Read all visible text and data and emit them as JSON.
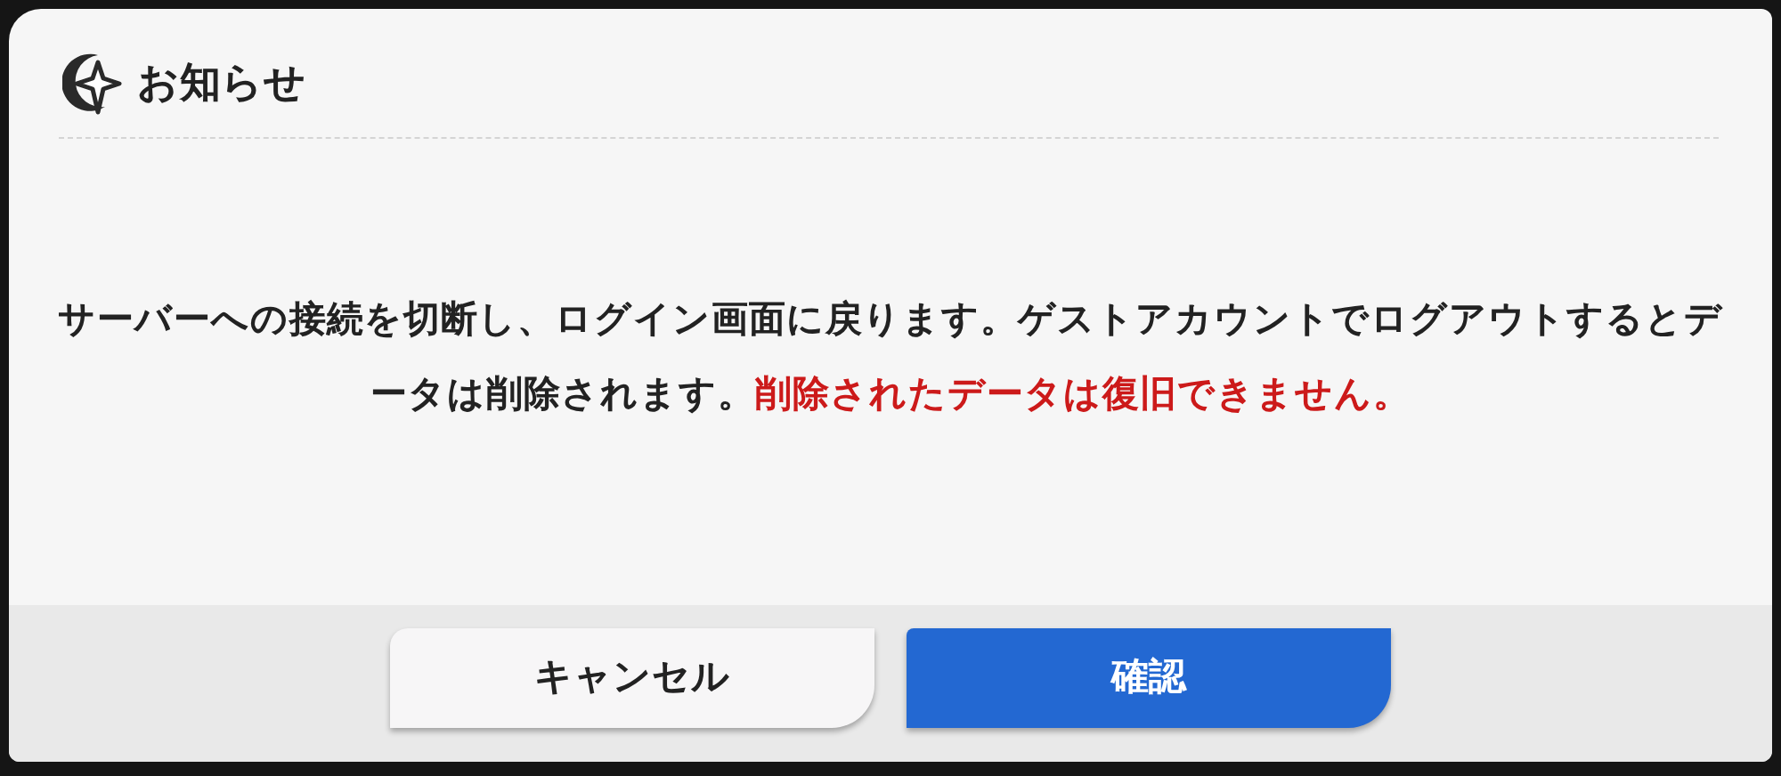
{
  "dialog": {
    "title": "お知らせ",
    "message": "サーバーへの接続を切断し、ログイン画面に戻ります。ゲストアカウントでログアウトするとデータは削除されます。",
    "warning": "削除されたデータは復旧できません。"
  },
  "buttons": [
    {
      "label": "キャンセル",
      "kind": "secondary"
    },
    {
      "label": "確認",
      "kind": "primary"
    }
  ]
}
